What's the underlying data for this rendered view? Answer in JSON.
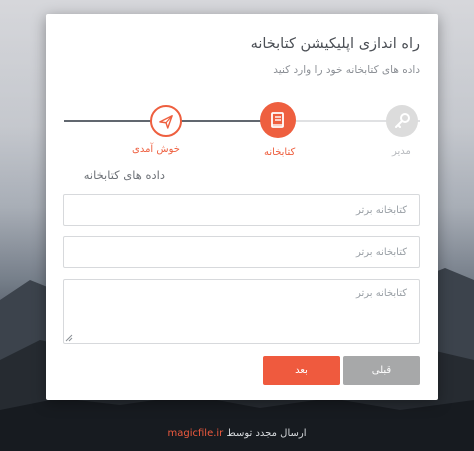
{
  "dialog": {
    "title": "راه اندازی اپلیکیشن کتابخانه",
    "subtitle": "داده های کتابخانه خود را وارد کنید"
  },
  "stepper": {
    "steps": [
      {
        "label": "خوش آمدی",
        "icon": "paper-plane-icon",
        "state": "done"
      },
      {
        "label": "کتابخانه",
        "icon": "book-icon",
        "state": "active"
      },
      {
        "label": "مدیر",
        "icon": "key-icon",
        "state": "pending"
      }
    ]
  },
  "form": {
    "section_title": "داده های کتابخانه",
    "fields": [
      {
        "placeholder": "کتابخانه برتر",
        "value": ""
      },
      {
        "placeholder": "کتابخانه برتر",
        "value": ""
      },
      {
        "placeholder": "کتابخانه برتر",
        "value": ""
      }
    ]
  },
  "buttons": {
    "next_label": "بعد",
    "prev_label": "قبلی"
  },
  "footer": {
    "prefix": "ارسال مجدد توسط",
    "brand": "magicfile.ir"
  },
  "colors": {
    "accent": "#ef5a3e",
    "disabled": "#a7a8a9",
    "line_done": "#61676f",
    "line_todo": "#e0e1e3"
  }
}
